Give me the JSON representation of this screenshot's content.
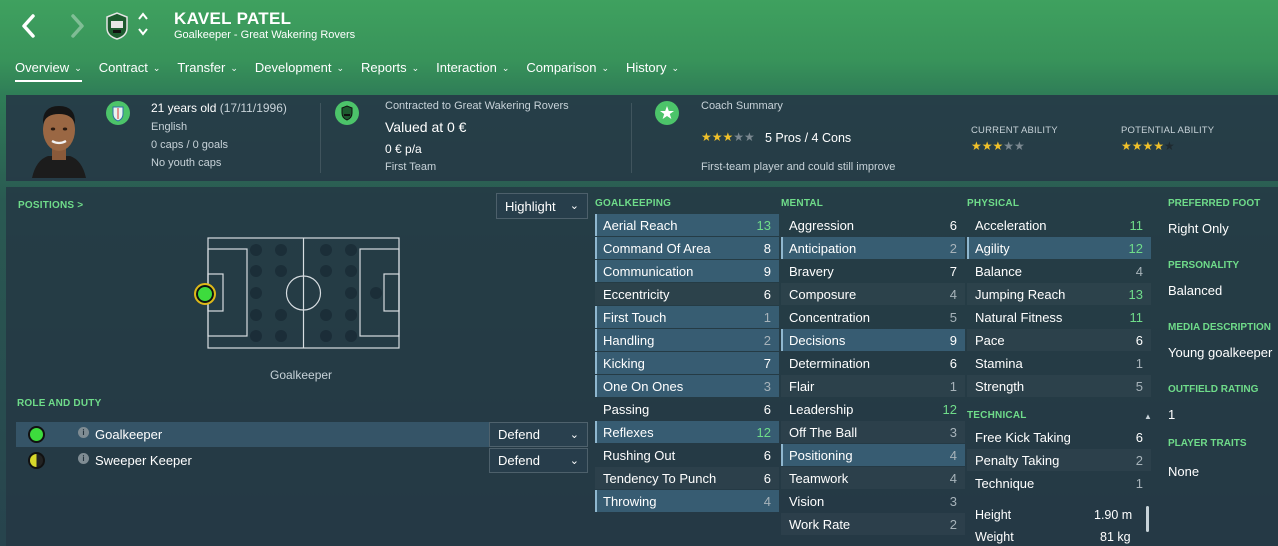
{
  "header": {
    "name": "KAVEL PATEL",
    "subtitle": "Goalkeeper - Great Wakering Rovers",
    "back_icon": "chevron-left-icon",
    "forward_icon": "chevron-right-icon"
  },
  "tabs": [
    {
      "label": "Overview",
      "active": true
    },
    {
      "label": "Contract"
    },
    {
      "label": "Transfer"
    },
    {
      "label": "Development"
    },
    {
      "label": "Reports"
    },
    {
      "label": "Interaction"
    },
    {
      "label": "Comparison"
    },
    {
      "label": "History"
    }
  ],
  "info": {
    "age": "21 years old",
    "dob": "(17/11/1996)",
    "nationality": "English",
    "caps": "0 caps / 0 goals",
    "youth_caps": "No youth caps",
    "contract_label": "Contracted to Great Wakering Rovers",
    "value": "Valued at 0 €",
    "wage": "0 € p/a",
    "squad": "First Team",
    "coach_title": "Coach Summary",
    "coach_stars": 3,
    "pros_cons": "5 Pros / 4 Cons",
    "coach_note": "First-team player and could still improve",
    "current_ability_label": "CURRENT ABILITY",
    "current_ability_stars": 3,
    "potential_ability_label": "POTENTIAL ABILITY",
    "potential_ability_stars": 4.5
  },
  "positions": {
    "title": "POSITIONS >",
    "highlight": "Highlight",
    "position_label": "Goalkeeper"
  },
  "roles": {
    "title": "ROLE AND DUTY",
    "items": [
      {
        "name": "Goalkeeper",
        "duty": "Defend",
        "color": "#3ddc3d"
      },
      {
        "name": "Sweeper Keeper",
        "duty": "Defend",
        "color": "#d7d82a"
      }
    ]
  },
  "goalkeeping": {
    "title": "GOALKEEPING",
    "attrs": [
      {
        "name": "Aerial Reach",
        "value": "13",
        "hl": true
      },
      {
        "name": "Command Of Area",
        "value": "8",
        "hl": true
      },
      {
        "name": "Communication",
        "value": "9",
        "hl": true
      },
      {
        "name": "Eccentricity",
        "value": "6"
      },
      {
        "name": "First Touch",
        "value": "1",
        "hl": true
      },
      {
        "name": "Handling",
        "value": "2",
        "hl": true
      },
      {
        "name": "Kicking",
        "value": "7",
        "hl": true
      },
      {
        "name": "One On Ones",
        "value": "3",
        "hl": true
      },
      {
        "name": "Passing",
        "value": "6"
      },
      {
        "name": "Reflexes",
        "value": "12",
        "hl": true
      },
      {
        "name": "Rushing Out",
        "value": "6"
      },
      {
        "name": "Tendency To Punch",
        "value": "6"
      },
      {
        "name": "Throwing",
        "value": "4",
        "hl": true
      }
    ]
  },
  "mental": {
    "title": "MENTAL",
    "attrs": [
      {
        "name": "Aggression",
        "value": "6"
      },
      {
        "name": "Anticipation",
        "value": "2",
        "hl": true
      },
      {
        "name": "Bravery",
        "value": "7"
      },
      {
        "name": "Composure",
        "value": "4"
      },
      {
        "name": "Concentration",
        "value": "5"
      },
      {
        "name": "Decisions",
        "value": "9",
        "hl": true
      },
      {
        "name": "Determination",
        "value": "6"
      },
      {
        "name": "Flair",
        "value": "1"
      },
      {
        "name": "Leadership",
        "value": "12"
      },
      {
        "name": "Off The Ball",
        "value": "3"
      },
      {
        "name": "Positioning",
        "value": "4",
        "hl": true
      },
      {
        "name": "Teamwork",
        "value": "4"
      },
      {
        "name": "Vision",
        "value": "3"
      },
      {
        "name": "Work Rate",
        "value": "2"
      }
    ]
  },
  "physical": {
    "title": "PHYSICAL",
    "attrs": [
      {
        "name": "Acceleration",
        "value": "11"
      },
      {
        "name": "Agility",
        "value": "12",
        "hl": true
      },
      {
        "name": "Balance",
        "value": "4"
      },
      {
        "name": "Jumping Reach",
        "value": "13"
      },
      {
        "name": "Natural Fitness",
        "value": "11"
      },
      {
        "name": "Pace",
        "value": "6"
      },
      {
        "name": "Stamina",
        "value": "1"
      },
      {
        "name": "Strength",
        "value": "5"
      }
    ]
  },
  "technical": {
    "title": "TECHNICAL",
    "attrs": [
      {
        "name": "Free Kick Taking",
        "value": "6"
      },
      {
        "name": "Penalty Taking",
        "value": "2"
      },
      {
        "name": "Technique",
        "value": "1"
      }
    ]
  },
  "body": {
    "height_label": "Height",
    "height": "1.90 m",
    "weight_label": "Weight",
    "weight": "81 kg"
  },
  "profile": {
    "preferred_foot_label": "PREFERRED FOOT",
    "preferred_foot": "Right Only",
    "personality_label": "PERSONALITY",
    "personality": "Balanced",
    "media_label": "MEDIA DESCRIPTION",
    "media": "Young goalkeeper",
    "outfield_label": "OUTFIELD RATING",
    "outfield": "1",
    "traits_label": "PLAYER TRAITS",
    "traits": "None"
  }
}
